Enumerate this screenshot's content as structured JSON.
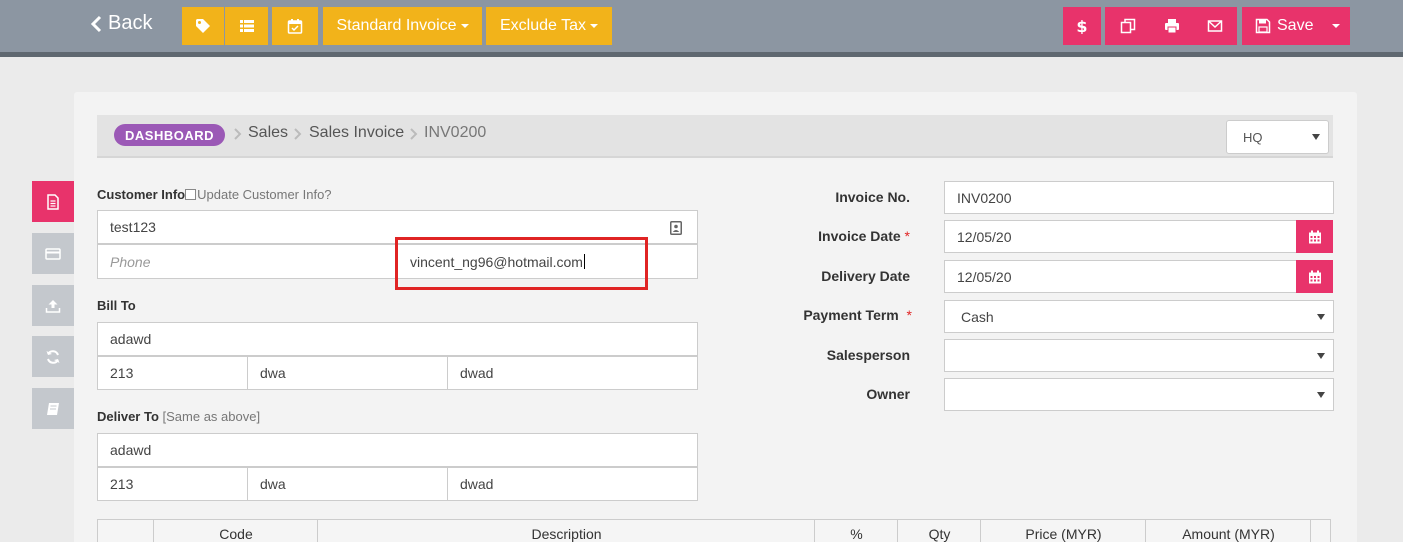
{
  "toolbar": {
    "back_label": "Back",
    "invoice_type_label": "Standard Invoice",
    "tax_label": "Exclude Tax",
    "save_label": "Save"
  },
  "breadcrumb": {
    "dashboard": "DASHBOARD",
    "items": [
      "Sales",
      "Sales Invoice",
      "INV0200"
    ]
  },
  "branch_select": {
    "value": "HQ"
  },
  "customer": {
    "label": "Customer Info",
    "update_label": "Update Customer Info?",
    "name": "test123",
    "phone_placeholder": "Phone",
    "email": "vincent_ng96@hotmail.com"
  },
  "bill_to": {
    "label": "Bill To",
    "line1": "adawd",
    "a": "213",
    "b": "dwa",
    "c": "dwad"
  },
  "deliver_to": {
    "label": "Deliver To",
    "same_label": "[Same as above]",
    "line1": "adawd",
    "a": "213",
    "b": "dwa",
    "c": "dwad"
  },
  "invoice": {
    "no_label": "Invoice No.",
    "no_value": "INV0200",
    "date_label": "Invoice Date",
    "date_value": "12/05/20",
    "delivery_label": "Delivery Date",
    "delivery_value": "12/05/20",
    "term_label": "Payment Term",
    "term_value": "Cash",
    "salesperson_label": "Salesperson",
    "salesperson_value": "",
    "owner_label": "Owner",
    "owner_value": "",
    "required_mark": "*"
  },
  "table": {
    "headers": [
      "Code",
      "Description",
      "%",
      "Qty",
      "Price (MYR)",
      "Amount (MYR)"
    ]
  },
  "colors": {
    "topbar": "#8c96a2",
    "yellow": "#f2b31a",
    "pink": "#e8336b",
    "purple": "#9b59b6",
    "highlight": "#e02424"
  }
}
